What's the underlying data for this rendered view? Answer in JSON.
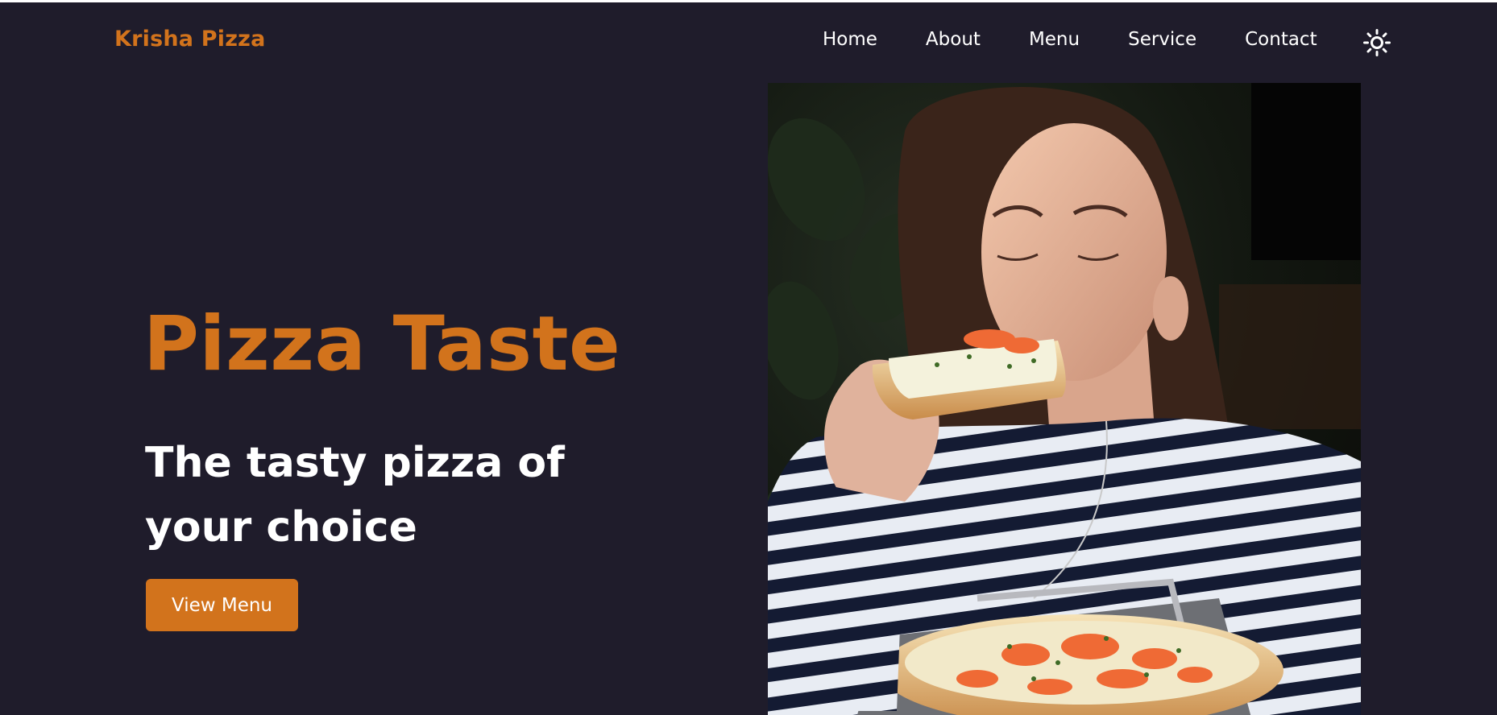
{
  "header": {
    "brand": "Krisha Pizza",
    "nav": [
      "Home",
      "About",
      "Menu",
      "Service",
      "Contact"
    ],
    "theme_toggle_icon": "sun-icon"
  },
  "hero": {
    "title": "Pizza Taste",
    "subtitle": "The tasty pizza of your choice",
    "button_label": "View Menu",
    "photo_icon": "pizza-photo"
  },
  "colors": {
    "accent": "#d2731c",
    "background": "#1f1c2b",
    "text": "#ffffff"
  }
}
